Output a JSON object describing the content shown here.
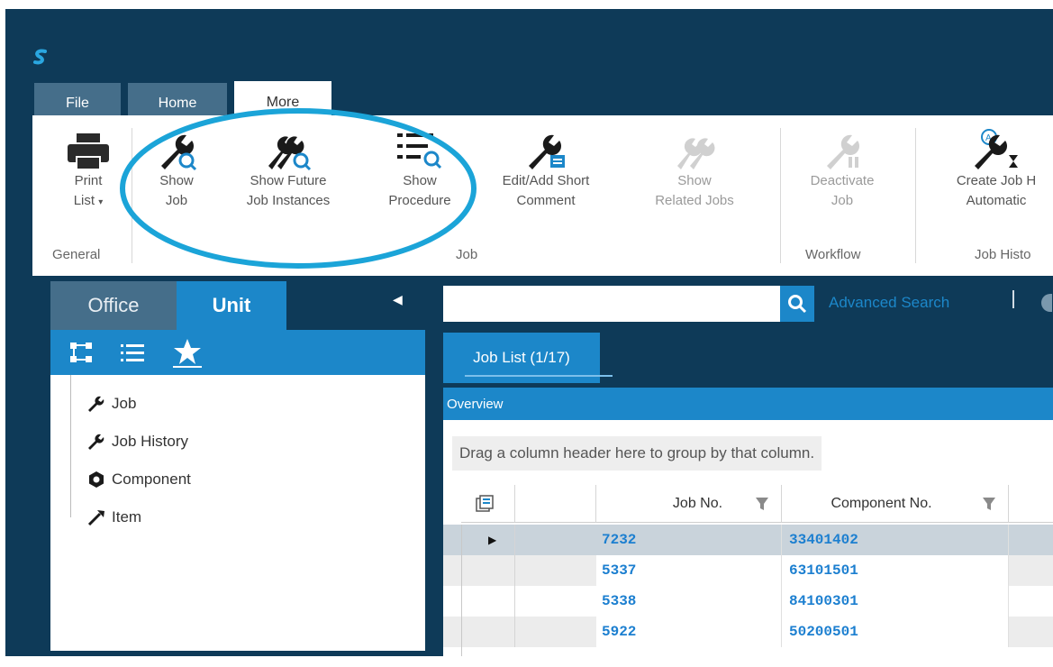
{
  "ribbon_tabs": [
    "File",
    "Home",
    "More"
  ],
  "ribbon": {
    "general": {
      "print_list_line1": "Print",
      "print_list_line2": "List",
      "group_label": "General"
    },
    "job": {
      "show_job_line1": "Show",
      "show_job_line2": "Job",
      "show_future_line1": "Show Future",
      "show_future_line2": "Job Instances",
      "show_procedure_line1": "Show",
      "show_procedure_line2": "Procedure",
      "edit_comment_line1": "Edit/Add Short",
      "edit_comment_line2": "Comment",
      "show_related_line1": "Show",
      "show_related_line2": "Related Jobs",
      "group_label": "Job"
    },
    "workflow": {
      "deactivate_line1": "Deactivate",
      "deactivate_line2": "Job",
      "group_label": "Workflow"
    },
    "job_history": {
      "create_line1": "Create Job H",
      "create_line2": "Automatic",
      "group_label": "Job Histo"
    }
  },
  "left_panel": {
    "tab_office": "Office",
    "tab_unit": "Unit",
    "tree": [
      "Job",
      "Job History",
      "Component",
      "Item"
    ]
  },
  "search": {
    "placeholder": "",
    "advanced_label": "Advanced Search"
  },
  "job_list": {
    "tab_label": "Job List (1/17)",
    "overview_label": "Overview",
    "group_hint": "Drag a column header here to group by that column.",
    "columns": [
      "Job No.",
      "Component No."
    ],
    "rows": [
      {
        "job_no": "7232",
        "component_no": "33401402"
      },
      {
        "job_no": "5337",
        "component_no": "63101501"
      },
      {
        "job_no": "5338",
        "component_no": "84100301"
      },
      {
        "job_no": "5922",
        "component_no": "50200501"
      }
    ]
  },
  "colors": {
    "app_bg": "#0e3a58",
    "accent": "#1c87c9",
    "highlight_ring": "#1ba4d8",
    "link_text": "#1c7fd0"
  }
}
